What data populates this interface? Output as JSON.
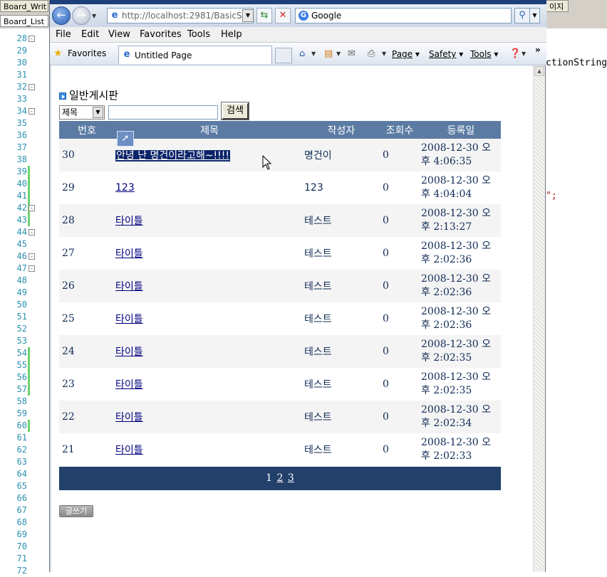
{
  "editor": {
    "tabs": [
      "Board_Writ",
      "Board_List",
      "이지"
    ],
    "line_numbers": [
      "28",
      "29",
      "30",
      "31",
      "32",
      "33",
      "34",
      "35",
      "36",
      "37",
      "38",
      "39",
      "40",
      "41",
      "42",
      "43",
      "44",
      "45",
      "46",
      "47",
      "48",
      "49",
      "50",
      "51",
      "52",
      "53",
      "54",
      "55",
      "56",
      "57",
      "58",
      "59",
      "60",
      "61",
      "62",
      "63",
      "64",
      "65",
      "66",
      "67",
      "68",
      "69",
      "70",
      "71",
      "72"
    ],
    "code_fragment_1": "ctionString",
    "code_fragment_2": "\";"
  },
  "browser": {
    "address": "http://localhost:2981/BasicS",
    "search_text": "Google",
    "menu": [
      "File",
      "Edit",
      "View",
      "Favorites",
      "Tools",
      "Help"
    ],
    "favorites_label": "Favorites",
    "tab_title": "Untitled Page",
    "commands": {
      "page": "Page",
      "safety": "Safety",
      "tools": "Tools"
    }
  },
  "page": {
    "board_title": "일반게시판",
    "search_field": "제목",
    "search_value": "",
    "search_button": "검색",
    "columns": [
      "번호",
      "제목",
      "작성자",
      "조회수",
      "등록일"
    ],
    "rows": [
      {
        "num": "30",
        "title": "안녕 난 명건이라고해~!!!!",
        "writer": "명건이",
        "views": "0",
        "date1": "2008-12-30 오",
        "date2": "후 4:06:35"
      },
      {
        "num": "29",
        "title": "123",
        "writer": "123",
        "views": "0",
        "date1": "2008-12-30 오",
        "date2": "후 4:04:04"
      },
      {
        "num": "28",
        "title": "타이틀",
        "writer": "테스트",
        "views": "0",
        "date1": "2008-12-30 오",
        "date2": "후 2:13:27"
      },
      {
        "num": "27",
        "title": "타이틀",
        "writer": "테스트",
        "views": "0",
        "date1": "2008-12-30 오",
        "date2": "후 2:02:36"
      },
      {
        "num": "26",
        "title": "타이틀",
        "writer": "테스트",
        "views": "0",
        "date1": "2008-12-30 오",
        "date2": "후 2:02:36"
      },
      {
        "num": "25",
        "title": "타이틀",
        "writer": "테스트",
        "views": "0",
        "date1": "2008-12-30 오",
        "date2": "후 2:02:36"
      },
      {
        "num": "24",
        "title": "타이틀",
        "writer": "테스트",
        "views": "0",
        "date1": "2008-12-30 오",
        "date2": "후 2:02:35"
      },
      {
        "num": "23",
        "title": "타이틀",
        "writer": "테스트",
        "views": "0",
        "date1": "2008-12-30 오",
        "date2": "후 2:02:35"
      },
      {
        "num": "22",
        "title": "타이틀",
        "writer": "테스트",
        "views": "0",
        "date1": "2008-12-30 오",
        "date2": "후 2:02:34"
      },
      {
        "num": "21",
        "title": "타이틀",
        "writer": "테스트",
        "views": "0",
        "date1": "2008-12-30 오",
        "date2": "후 2:02:33"
      }
    ],
    "pager": {
      "current": "1",
      "links": [
        "2",
        "3"
      ]
    },
    "write_button": "글쓰기"
  },
  "colors": {
    "header_bg": "#5b7ba3",
    "pager_bg": "#23406b",
    "selection_bg": "#0a246a",
    "link": "#000080",
    "change_marker": "#6ed16e",
    "line_number": "#2b91af"
  },
  "icons": [
    "back-arrow-icon",
    "forward-arrow-icon",
    "ie-page-icon",
    "refresh-icon",
    "stop-icon",
    "google-icon",
    "search-icon",
    "star-icon",
    "home-icon",
    "feeds-icon",
    "mail-icon",
    "print-icon",
    "help-icon",
    "bullet-icon",
    "link-drag-icon",
    "mouse-cursor-icon"
  ]
}
